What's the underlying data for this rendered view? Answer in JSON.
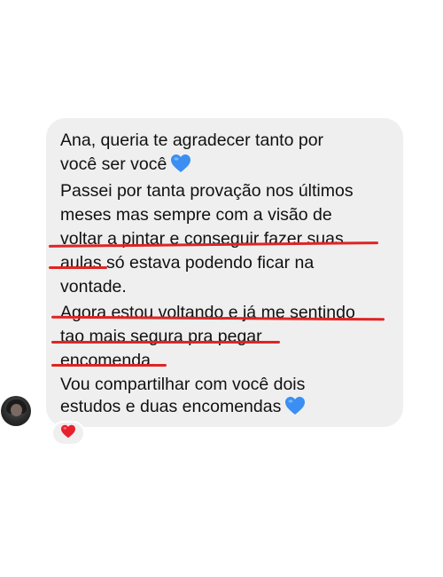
{
  "message": {
    "lines": [
      "Ana, queria te agradecer tanto por",
      "você ser você",
      "Passei por tanta provação nos últimos",
      "meses mas sempre com a visão de",
      "voltar a pintar e conseguir fazer suas",
      "aulas só estava podendo ficar na",
      "vontade.",
      "Agora estou voltando e já me sentindo",
      "tao mais segura pra pegar",
      "encomenda.",
      "Vou compartilhar com você dois",
      "estudos e duas encomendas"
    ]
  },
  "icons": {
    "emoji_1": "blue-heart-icon",
    "emoji_2": "blue-heart-icon",
    "reaction": "red-heart-icon",
    "avatar": "avatar"
  },
  "colors": {
    "bubble": "#efefef",
    "text": "#111111",
    "underline": "#e02424",
    "blue_heart": "#3b8ff3",
    "red_heart": "#e8202e"
  }
}
